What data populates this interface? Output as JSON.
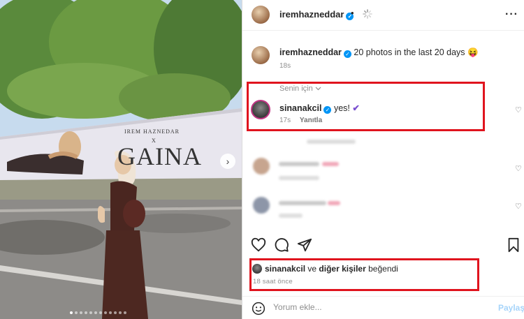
{
  "post": {
    "author": "iremhazneddar",
    "header_separator": "•",
    "caption_text": "20 photos in the last 20 days",
    "caption_emoji": "😝",
    "caption_time": "18s"
  },
  "billboard": {
    "name": "IREM HAZNEDAR",
    "x": "X",
    "brand": "GAINA"
  },
  "carousel": {
    "slide_count": 12,
    "active_index": 0
  },
  "comments": {
    "section_label": "Senin için",
    "featured": {
      "username": "sinanakcil",
      "text": "yes!",
      "emoji": "✔",
      "time": "17s",
      "reply_label": "Yanıtla"
    }
  },
  "likes": {
    "liker": "sinanakcil",
    "connector": "ve",
    "others": "diğer kişiler",
    "suffix": "beğendi",
    "time": "18 saat önce"
  },
  "comment_box": {
    "placeholder": "Yorum ekle...",
    "post_label": "Paylaş"
  },
  "colors": {
    "highlight_border": "#e0141e",
    "verified": "#0095f6",
    "post_button_disabled": "#a6d4fa"
  },
  "icons": [
    "chevron-right-icon",
    "verified-icon",
    "loading-spinner-icon",
    "more-icon",
    "chevron-down-icon",
    "heart-icon",
    "comment-icon",
    "share-icon",
    "bookmark-icon",
    "emoji-icon"
  ]
}
